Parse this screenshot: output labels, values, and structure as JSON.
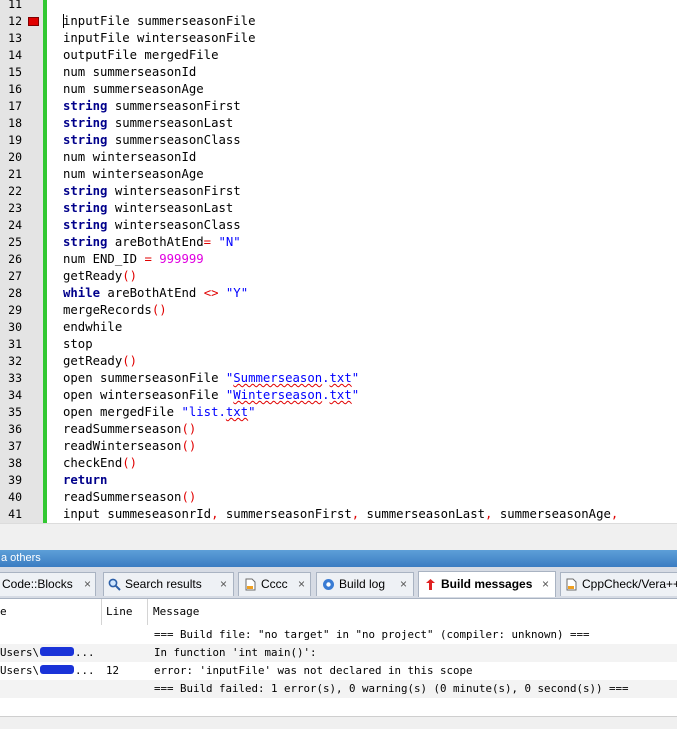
{
  "editor": {
    "lines": [
      {
        "num": "11",
        "html": ""
      },
      {
        "num": "12",
        "html": "<span class=\"caret\"></span>inputFile summerseasonFile",
        "breakpoint": true
      },
      {
        "num": "13",
        "html": "inputFile winterseasonFile"
      },
      {
        "num": "14",
        "html": "outputFile mergedFile"
      },
      {
        "num": "15",
        "html": "num summerseasonId"
      },
      {
        "num": "16",
        "html": "num summerseasonAge"
      },
      {
        "num": "17",
        "html": "<span class=\"kw\">string</span> summerseasonFirst"
      },
      {
        "num": "18",
        "html": "<span class=\"kw\">string</span> summerseasonLast"
      },
      {
        "num": "19",
        "html": "<span class=\"kw\">string</span> summerseasonClass"
      },
      {
        "num": "20",
        "html": "num winterseasonId"
      },
      {
        "num": "21",
        "html": "num winterseasonAge"
      },
      {
        "num": "22",
        "html": "<span class=\"kw\">string</span> winterseasonFirst"
      },
      {
        "num": "23",
        "html": "<span class=\"kw\">string</span> winterseasonLast"
      },
      {
        "num": "24",
        "html": "<span class=\"kw\">string</span> winterseasonClass"
      },
      {
        "num": "25",
        "html": "<span class=\"kw\">string</span> areBothAtEnd<span class=\"op\">=</span> <span class=\"str\">\"N\"</span>"
      },
      {
        "num": "26",
        "html": "num END_ID <span class=\"op\">=</span> <span class=\"num\">999999</span>"
      },
      {
        "num": "27",
        "html": "getReady<span class=\"op\">()</span>"
      },
      {
        "num": "28",
        "html": "<span class=\"kw\">while</span> areBothAtEnd <span class=\"op\">&lt;&gt;</span> <span class=\"str\">\"Y\"</span>"
      },
      {
        "num": "29",
        "html": "mergeRecords<span class=\"op\">()</span>"
      },
      {
        "num": "30",
        "html": "endwhile"
      },
      {
        "num": "31",
        "html": "stop"
      },
      {
        "num": "32",
        "html": "getReady<span class=\"op\">()</span>"
      },
      {
        "num": "33",
        "html": "open summerseasonFile <span class=\"str\">\"<span class=\"sq\">Summerseason</span>.<span class=\"sq\">txt</span>\"</span>"
      },
      {
        "num": "34",
        "html": "open winterseasonFile <span class=\"str\">\"<span class=\"sq\">Winterseason</span>.<span class=\"sq\">txt</span>\"</span>"
      },
      {
        "num": "35",
        "html": "open mergedFile <span class=\"str\">\"list.<span class=\"sq\">txt</span>\"</span>"
      },
      {
        "num": "36",
        "html": "readSummerseason<span class=\"op\">()</span>"
      },
      {
        "num": "37",
        "html": "readWinterseason<span class=\"op\">()</span>"
      },
      {
        "num": "38",
        "html": "checkEnd<span class=\"op\">()</span>"
      },
      {
        "num": "39",
        "html": "<span class=\"kw\">return</span>"
      },
      {
        "num": "40",
        "html": "readSummerseason<span class=\"op\">()</span>"
      },
      {
        "num": "41",
        "html": "input summeseasonrId<span class=\"op\">,</span> summerseasonFirst<span class=\"op\">,</span> summerseasonLast<span class=\"op\">,</span> summerseasonAge<span class=\"op\">,</span>"
      }
    ]
  },
  "panel": {
    "title": "a others",
    "tabs": [
      {
        "name": "tab-codeblocks",
        "label": "Code::Blocks",
        "icon": "none"
      },
      {
        "name": "tab-search-results",
        "label": "Search results",
        "icon": "magnifier-icon"
      },
      {
        "name": "tab-cccc",
        "label": "Cccc",
        "icon": "document-icon"
      },
      {
        "name": "tab-build-log",
        "label": "Build log",
        "icon": "gear-icon"
      },
      {
        "name": "tab-build-messages",
        "label": "Build messages",
        "icon": "build-messages-icon",
        "active": true
      },
      {
        "name": "tab-cppcheck-vera",
        "label": "CppCheck/Vera++",
        "icon": "document-icon"
      }
    ],
    "close_glyph": "×",
    "columns": {
      "file": "e",
      "line": "Line",
      "message": "Message"
    },
    "rows": [
      {
        "file": "",
        "line": "",
        "message": "=== Build file: \"no target\" in \"no project\" (compiler: unknown) ==="
      },
      {
        "file": "Users\\",
        "file_suffix": "...",
        "line": "",
        "message": "In function 'int main()':"
      },
      {
        "file": "Users\\",
        "file_suffix": "...",
        "line": "12",
        "message": "error: 'inputFile' was not declared in this scope"
      },
      {
        "file": "",
        "line": "",
        "message": "=== Build failed: 1 error(s), 0 warning(s) (0 minute(s), 0 second(s)) ==="
      }
    ]
  },
  "colors": {
    "fold_bar": "#32c832",
    "breakpoint": "#e00000",
    "keyword": "#00008b",
    "string": "#0000ff",
    "number": "#e000e0"
  }
}
